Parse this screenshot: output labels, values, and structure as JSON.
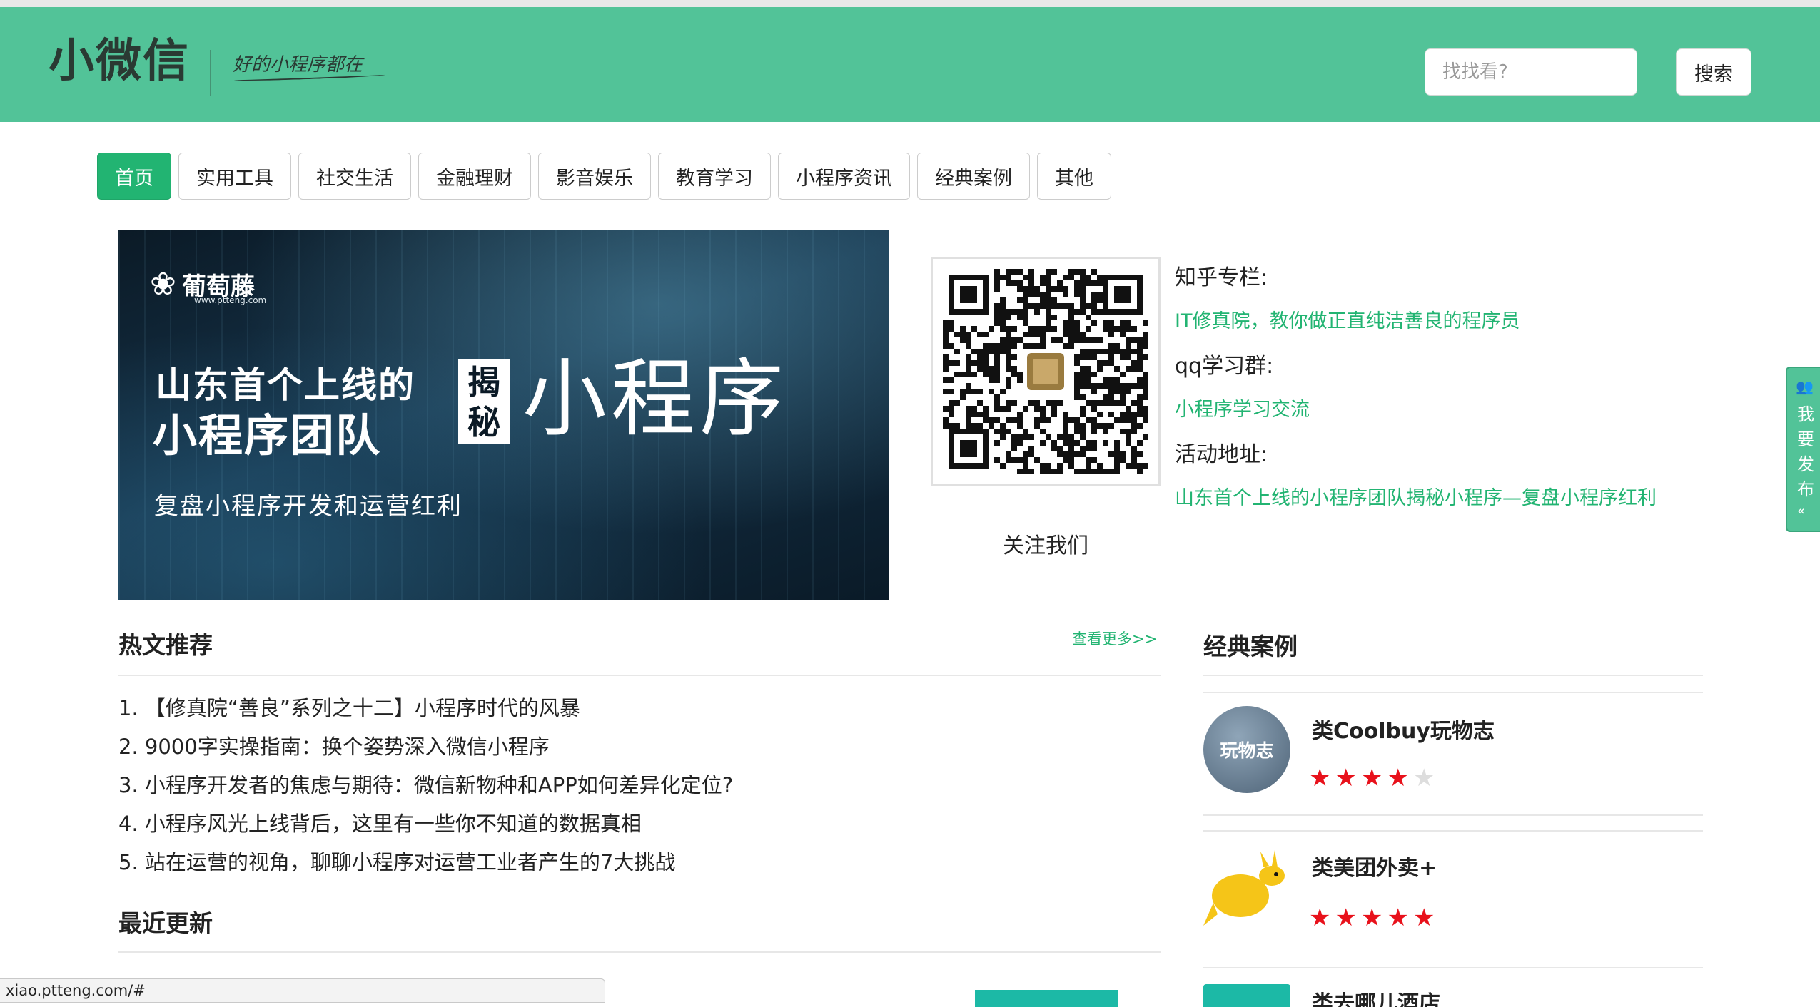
{
  "header": {
    "logo": "小微信",
    "slogan": "好的小程序都在",
    "search": {
      "placeholder": "找找看?",
      "button": "搜索"
    }
  },
  "nav": {
    "items": [
      {
        "label": "首页",
        "active": true
      },
      {
        "label": "实用工具"
      },
      {
        "label": "社交生活"
      },
      {
        "label": "金融理财"
      },
      {
        "label": "影音娱乐"
      },
      {
        "label": "教育学习"
      },
      {
        "label": "小程序资讯"
      },
      {
        "label": "经典案例"
      },
      {
        "label": "其他"
      }
    ]
  },
  "banner": {
    "brand": "葡萄藤",
    "brand_url": "www.ptteng.com",
    "line1": "山东首个上线的",
    "line2": "小程序团队",
    "tag": "揭秘",
    "big": "小程序",
    "sub": "复盘小程序开发和运营红利"
  },
  "qr": {
    "caption": "关注我们"
  },
  "info": {
    "zhihu_label": "知乎专栏:",
    "zhihu_link": "IT修真院，教你做正直纯洁善良的程序员",
    "qq_label": "qq学习群:",
    "qq_link": "小程序学习交流",
    "event_label": "活动地址:",
    "event_link": "山东首个上线的小程序团队揭秘小程序—复盘小程序红利"
  },
  "side_tab": {
    "text": "我要发布",
    "arrow": "«"
  },
  "hot": {
    "title": "热文推荐",
    "more": "查看更多>>",
    "items": [
      "1. 【修真院“善良”系列之十二】小程序时代的风暴",
      "2. 9000字实操指南：换个姿势深入微信小程序",
      "3. 小程序开发者的焦虑与期待：微信新物种和APP如何差异化定位?",
      "4. 小程序风光上线背后，这里有一些你不知道的数据真相",
      "5. 站在运营的视角，聊聊小程序对运营工业者产生的7大挑战"
    ]
  },
  "recent": {
    "title": "最近更新"
  },
  "cases": {
    "title": "经典案例",
    "items": [
      {
        "name": "类Coolbuy玩物志",
        "icon_text": "玩物志",
        "rating": 4,
        "max": 5
      },
      {
        "name": "类美团外卖+",
        "rating": 5,
        "max": 5
      },
      {
        "name": "类去哪儿酒店"
      }
    ]
  },
  "status_bar": {
    "url": "xiao.ptteng.com/#"
  },
  "colors": {
    "header": "#52c398",
    "accent": "#22b472",
    "star": "#e8111b"
  }
}
